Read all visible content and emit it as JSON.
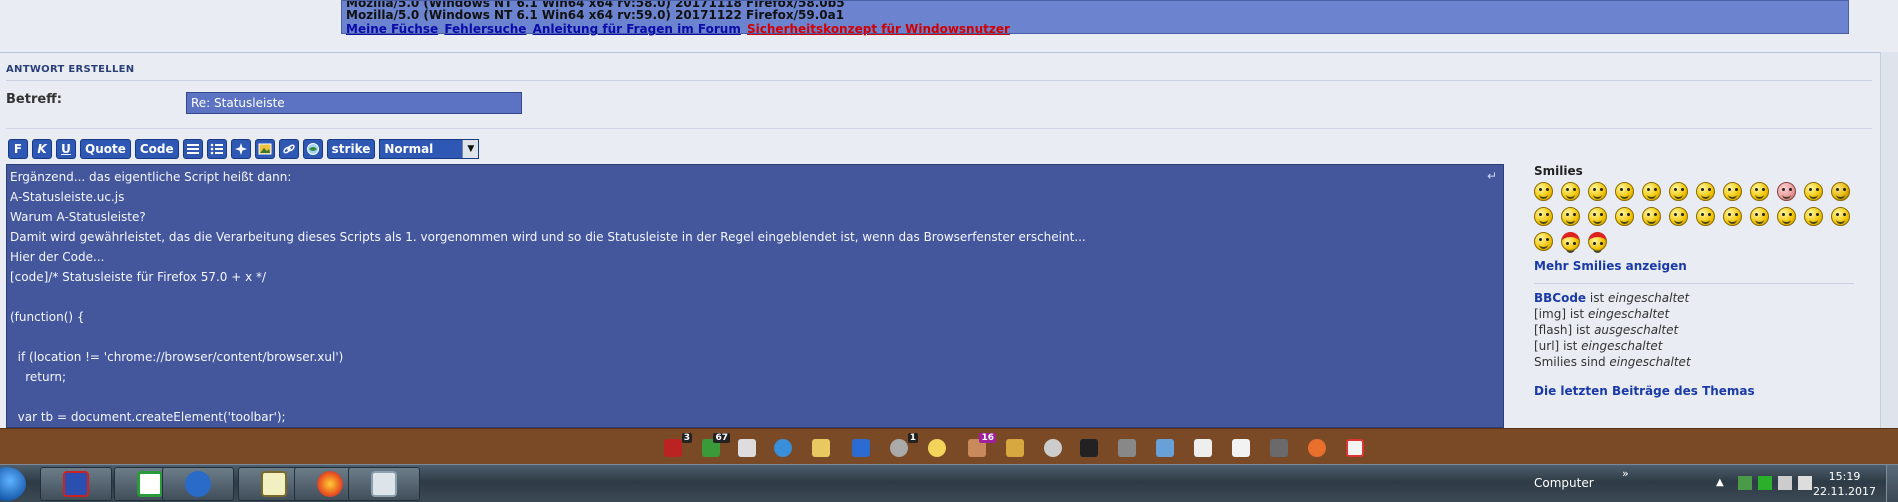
{
  "signature": {
    "line1": "Mozilla/5.0 (Windows NT 6.1 Win64 x64 rv:58.0) 20171118 Firefox/58.0b5",
    "line2": "Mozilla/5.0 (Windows NT 6.1 Win64 x64 rv:59.0) 20171122 Firefox/59.0a1",
    "links": [
      "Meine Füchse",
      "Fehlersuche",
      "Anleitung für Fragen im Forum",
      "Sicherheitskonzept für Windowsnutzer"
    ],
    "link_colors": {
      "normal": "#0b0ba8",
      "warning": "#d20000"
    }
  },
  "reply": {
    "section_title": "ANTWORT ERSTELLEN",
    "subject_label": "Betreff:",
    "subject_value": "Re: Statusleiste"
  },
  "toolbar": {
    "bold": "F",
    "italic": "K",
    "underline": "U",
    "quote": "Quote",
    "code": "Code",
    "strike": "strike",
    "size_select": "Normal",
    "icons": [
      "list-icon",
      "bullet-list-icon",
      "list-item-icon",
      "image-icon",
      "link-icon",
      "email-icon"
    ]
  },
  "editor": {
    "lines": [
      "Ergänzend... das eigentliche Script heißt dann:",
      "A-Statusleiste.uc.js",
      "Warum A-Statusleiste?",
      "Damit wird gewährleistet, das die Verarbeitung dieses Scripts als 1. vorgenommen wird und so die Statusleiste in der Regel eingeblendet ist, wenn das Browserfenster erscheint...",
      "Hier der Code...",
      "[code]/* Statusleiste für Firefox 57.0 + x */",
      "",
      "(function() {",
      "",
      "  if (location != 'chrome://browser/content/browser.xul')",
      "    return;",
      "",
      "  var tb = document.createElement('toolbar');"
    ]
  },
  "sidebar": {
    "smilies_title": "Smilies",
    "more_smilies": "Mehr Smilies anzeigen",
    "options": [
      {
        "key": "BBCode",
        "mid": " ist ",
        "state": "eingeschaltet",
        "link": true
      },
      {
        "key": "[img]",
        "mid": " ist ",
        "state": "eingeschaltet",
        "link": false
      },
      {
        "key": "[flash]",
        "mid": " ist ",
        "state": "ausgeschaltet",
        "link": false
      },
      {
        "key": "[url]",
        "mid": " ist ",
        "state": "eingeschaltet",
        "link": false
      },
      {
        "key": "Smilies",
        "mid": " sind ",
        "state": "eingeschaltet",
        "link": false
      }
    ],
    "latest_posts": "Die letzten Beiträge des Themas"
  },
  "quickbar": {
    "badges": [
      "3",
      "67",
      "1",
      "16"
    ]
  },
  "taskbar": {
    "tray_label": "Computer",
    "time": "15:19",
    "date": "22.11.2017"
  }
}
